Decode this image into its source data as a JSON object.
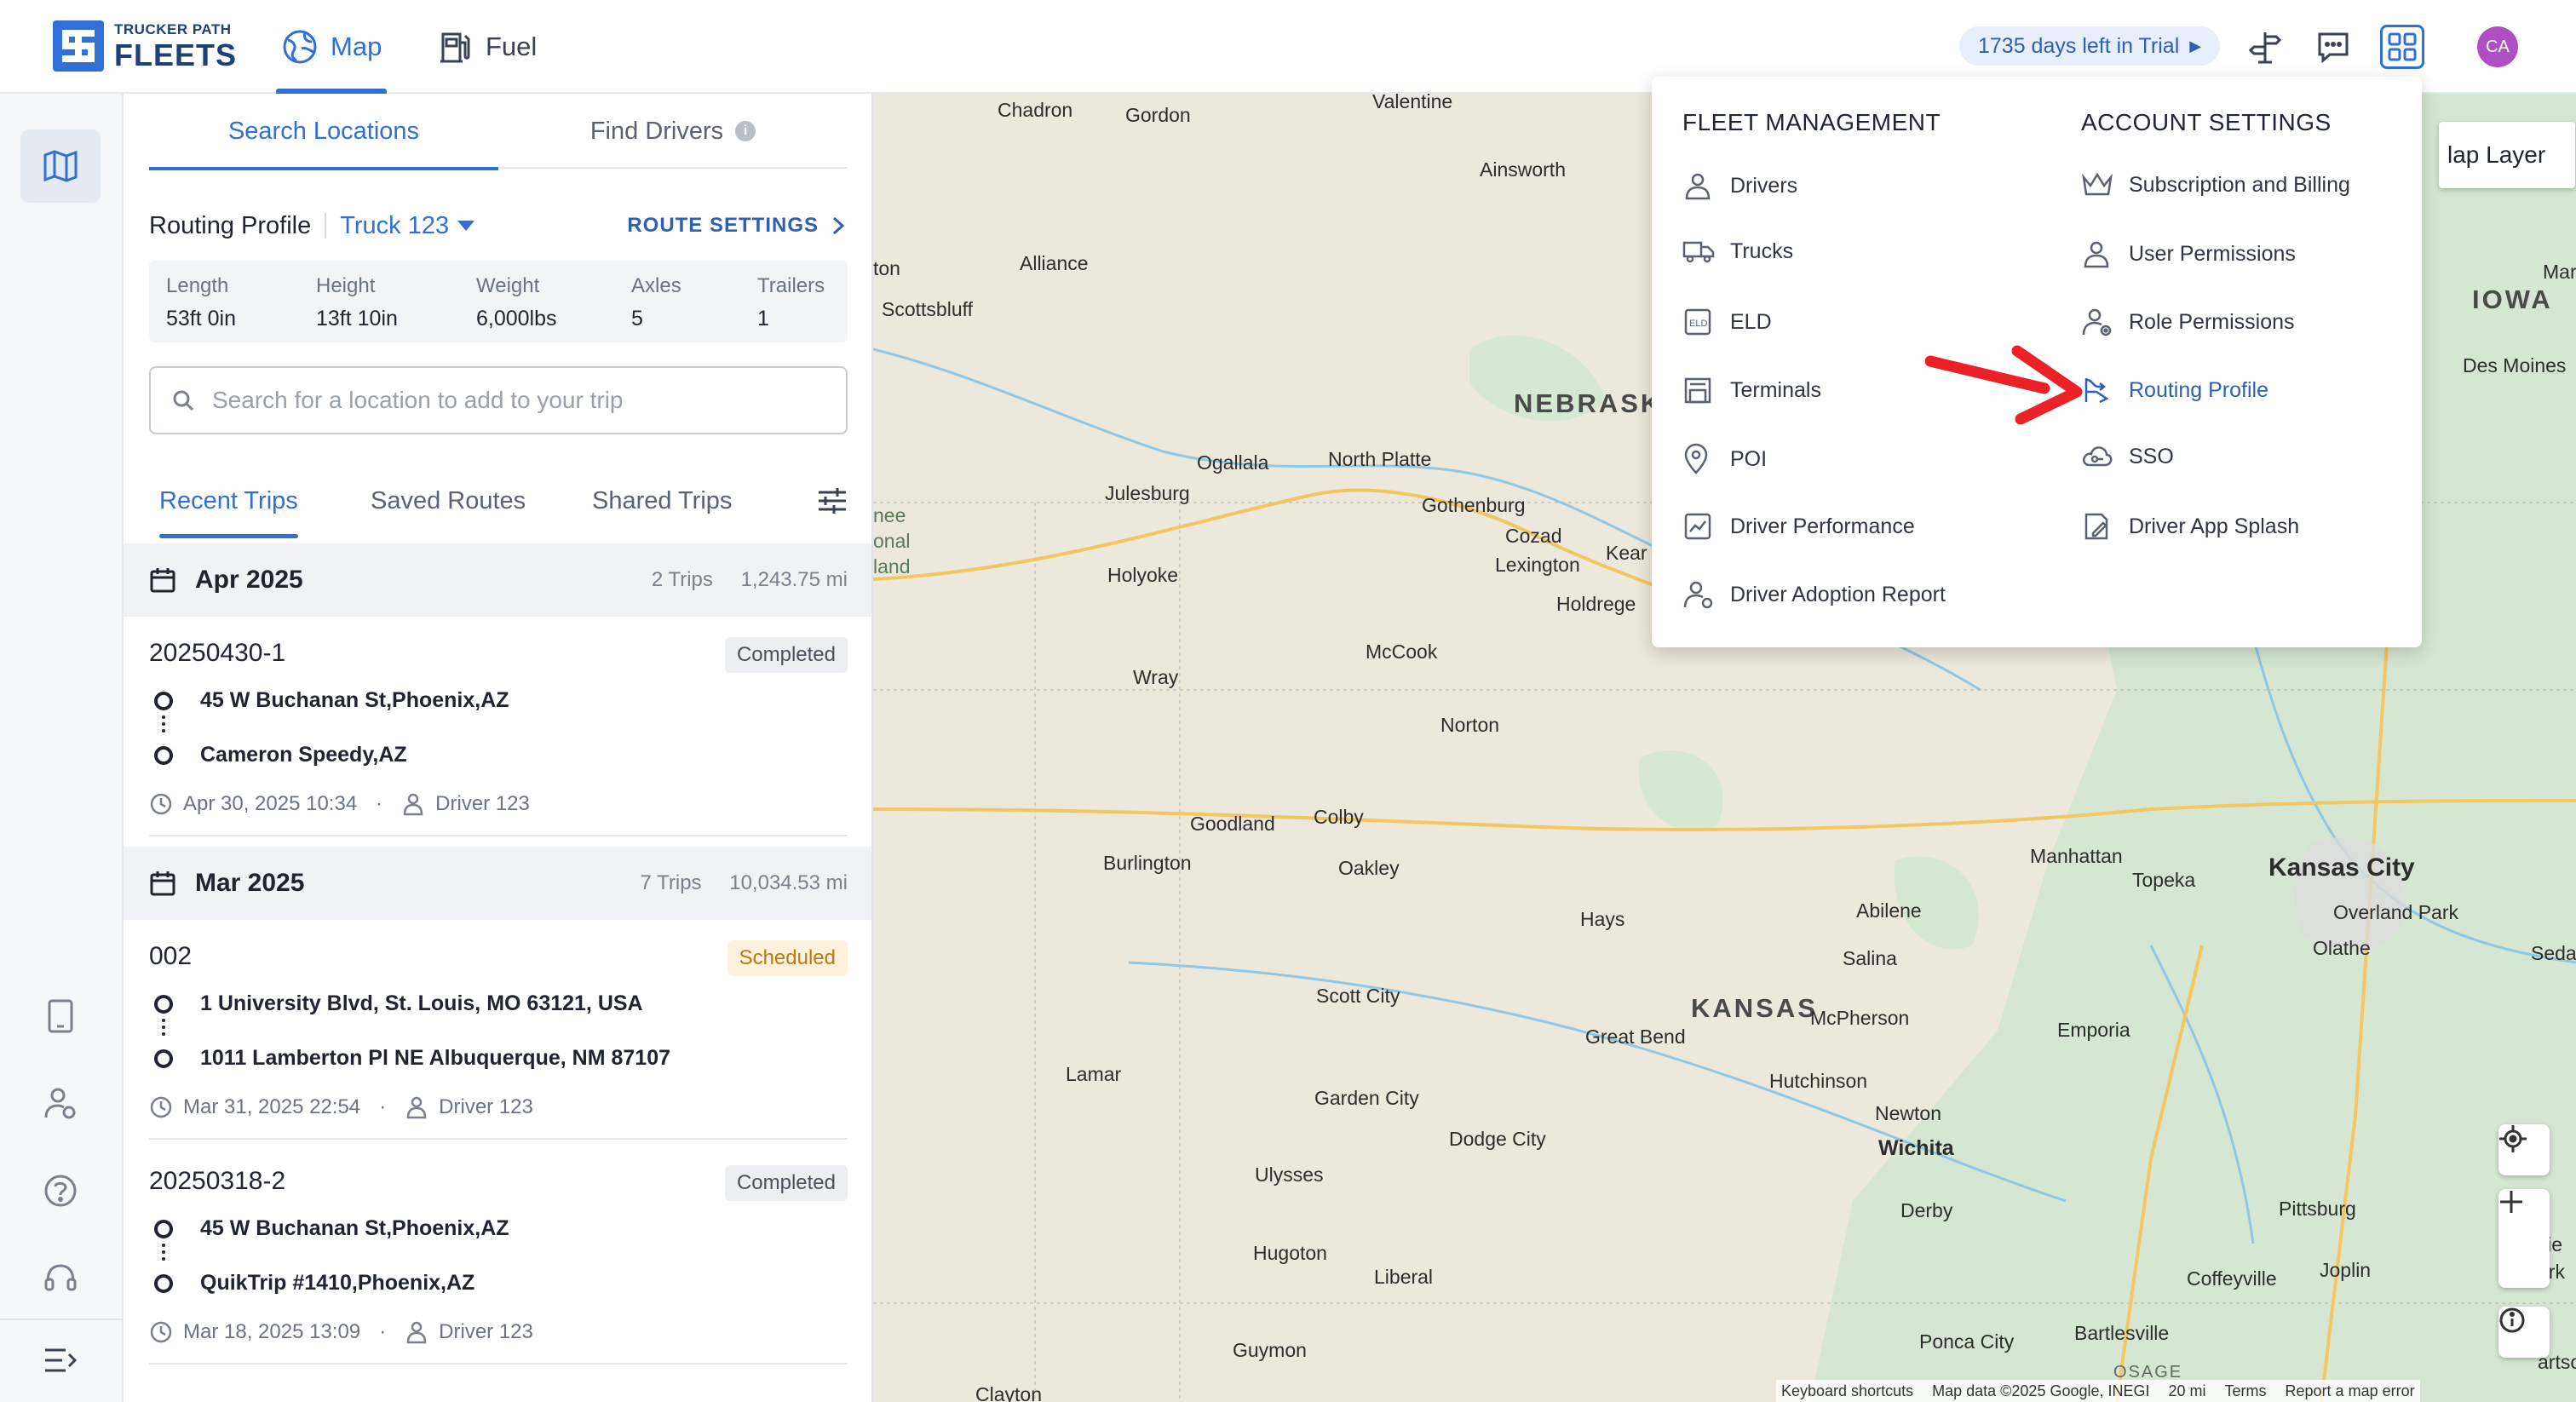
{
  "logo": {
    "small": "TRUCKER PATH",
    "big": "FLEETS"
  },
  "nav": {
    "map": "Map",
    "fuel": "Fuel"
  },
  "trial": {
    "label": "1735 days left in Trial"
  },
  "avatar": {
    "initials": "CA"
  },
  "panel": {
    "tabs": {
      "search": "Search Locations",
      "drivers": "Find Drivers"
    },
    "routing": {
      "label": "Routing Profile",
      "truck": "Truck 123",
      "settings": "ROUTE SETTINGS"
    },
    "specs": [
      {
        "k": "Length",
        "v": "53ft 0in"
      },
      {
        "k": "Height",
        "v": "13ft 10in"
      },
      {
        "k": "Weight",
        "v": "6,000lbs"
      },
      {
        "k": "Axles",
        "v": "5"
      },
      {
        "k": "Trailers",
        "v": "1"
      }
    ],
    "search_placeholder": "Search for a location to add to your trip",
    "trip_tabs": {
      "recent": "Recent Trips",
      "saved": "Saved Routes",
      "shared": "Shared Trips"
    },
    "months": [
      {
        "title": "Apr 2025",
        "trips": "2 Trips",
        "miles": "1,243.75 mi"
      },
      {
        "title": "Mar 2025",
        "trips": "7 Trips",
        "miles": "10,034.53 mi"
      }
    ],
    "trips": [
      {
        "name": "20250430-1",
        "status": "Completed",
        "from": "45 W Buchanan St,Phoenix,AZ",
        "to": "Cameron Speedy,AZ",
        "date": "Apr 30, 2025 10:34",
        "driver": "Driver 123"
      },
      {
        "name": "002",
        "status": "Scheduled",
        "from": "1 University Blvd, St. Louis, MO 63121, USA",
        "to": "1011 Lamberton Pl NE Albuquerque, NM 87107",
        "date": "Mar 31, 2025 22:54",
        "driver": "Driver 123"
      },
      {
        "name": "20250318-2",
        "status": "Completed",
        "from": "45 W Buchanan St,Phoenix,AZ",
        "to": "QuikTrip #1410,Phoenix,AZ",
        "date": "Mar 18, 2025 13:09",
        "driver": "Driver 123"
      }
    ]
  },
  "menu": {
    "fleet_title": "FLEET MANAGEMENT",
    "account_title": "ACCOUNT SETTINGS",
    "fleet": [
      "Drivers",
      "Trucks",
      "ELD",
      "Terminals",
      "POI",
      "Driver Performance",
      "Driver Adoption Report"
    ],
    "account": [
      "Subscription and Billing",
      "User Permissions",
      "Role Permissions",
      "Routing Profile",
      "SSO",
      "Driver App Splash"
    ]
  },
  "map": {
    "layer_button": "Map Layer",
    "layer_visible": "lap Layer",
    "states": {
      "nebraska": "NEBRASKA",
      "kansas": "KANSAS",
      "iowa": "IOWA"
    },
    "cities": [
      "Chadron",
      "Gordon",
      "Valentine",
      "Ainsworth",
      "Alliance",
      "Scottsbluff",
      "Ogallala",
      "North Platte",
      "Julesburg",
      "Gothenburg",
      "Cozad",
      "Lexington",
      "Holyoke",
      "Holdrege",
      "Kear",
      "McCook",
      "Wray",
      "Norton",
      "Goodland",
      "Colby",
      "Burlington",
      "Oakley",
      "Hays",
      "Scott City",
      "Great Bend",
      "McPherson",
      "Salina",
      "Abilene",
      "Manhattan",
      "Topeka",
      "Kansas City",
      "Overland Park",
      "Olathe",
      "Emporia",
      "Hutchinson",
      "Newton",
      "Wichita",
      "Lamar",
      "Garden City",
      "Dodge City",
      "Ulysses",
      "Hugoton",
      "Liberal",
      "Guymon",
      "Ponca City",
      "Bartlesville",
      "Coffeyville",
      "Pittsburg",
      "Joplin",
      "Derby",
      "Des Moines",
      "Clayton",
      "ton",
      "nee",
      "onal",
      "land",
      "Mar",
      "Sedali",
      "gfie",
      "ark",
      "artso",
      "OSAGE"
    ],
    "attribution": [
      "Keyboard shortcuts",
      "Map data ©2025 Google, INEGI",
      "20 mi",
      "Terms",
      "Report a map error"
    ]
  }
}
